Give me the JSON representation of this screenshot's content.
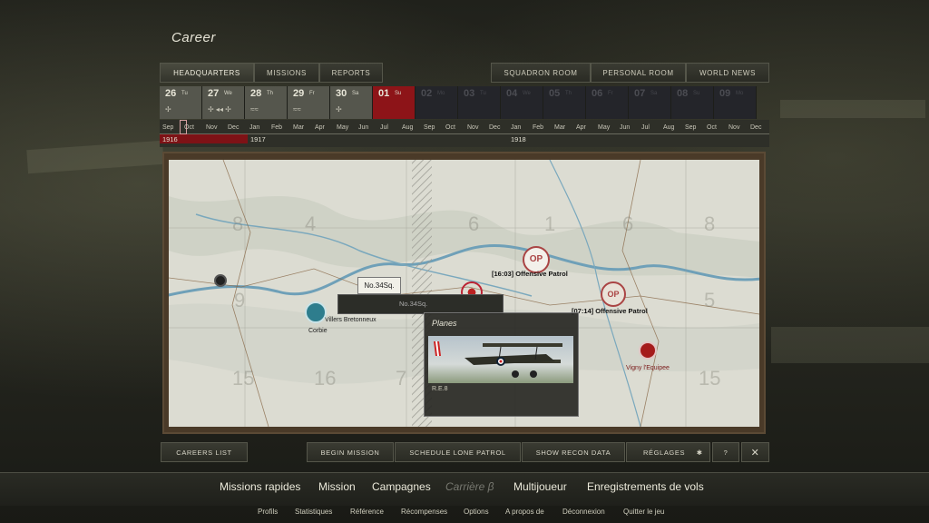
{
  "page": {
    "title": "Career"
  },
  "top_tabs_left": [
    {
      "label": "HEADQUARTERS",
      "active": true
    },
    {
      "label": "MISSIONS",
      "active": false
    },
    {
      "label": "REPORTS",
      "active": false
    }
  ],
  "top_tabs_right": [
    {
      "label": "SQUADRON ROOM"
    },
    {
      "label": "PERSONAL ROOM"
    },
    {
      "label": "WORLD NEWS"
    }
  ],
  "calendar_days": [
    {
      "num": "26",
      "day": "Tu",
      "weather": "✢",
      "state": "past"
    },
    {
      "num": "27",
      "day": "We",
      "weather": "✢ ◂◂ ✢",
      "state": "past"
    },
    {
      "num": "28",
      "day": "Th",
      "weather": "≈≈",
      "state": "past"
    },
    {
      "num": "29",
      "day": "Fr",
      "weather": "≈≈",
      "state": "past"
    },
    {
      "num": "30",
      "day": "Sa",
      "weather": "✢",
      "state": "past"
    },
    {
      "num": "01",
      "day": "Su",
      "weather": "",
      "state": "today"
    },
    {
      "num": "02",
      "day": "Mo",
      "weather": "",
      "state": "future"
    },
    {
      "num": "03",
      "day": "Tu",
      "weather": "",
      "state": "future"
    },
    {
      "num": "04",
      "day": "We",
      "weather": "",
      "state": "future"
    },
    {
      "num": "05",
      "day": "Th",
      "weather": "",
      "state": "future"
    },
    {
      "num": "06",
      "day": "Fr",
      "weather": "",
      "state": "future"
    },
    {
      "num": "07",
      "day": "Sa",
      "weather": "",
      "state": "future"
    },
    {
      "num": "08",
      "day": "Su",
      "weather": "",
      "state": "future"
    },
    {
      "num": "09",
      "day": "Mo",
      "weather": "",
      "state": "future"
    }
  ],
  "timeline": {
    "months": [
      "Sep",
      "Oct",
      "Nov",
      "Dec",
      "Jan",
      "Feb",
      "Mar",
      "Apr",
      "May",
      "Jun",
      "Jul",
      "Aug",
      "Sep",
      "Oct",
      "Nov",
      "Dec",
      "Jan",
      "Feb",
      "Mar",
      "Apr",
      "May",
      "Jun",
      "Jul",
      "Aug",
      "Sep",
      "Oct",
      "Nov",
      "Dec"
    ],
    "years": [
      "1916",
      "1917",
      "1918"
    ]
  },
  "map": {
    "grid_numbers": [
      "8",
      "4",
      "6",
      "1",
      "6",
      "8",
      "9",
      "5",
      "9",
      "15",
      "16",
      "7",
      "15"
    ],
    "towns": [
      "Corbie",
      "Villers Bretonneux",
      "Vigny l'Equipee"
    ],
    "patrols": [
      {
        "time_label": "[16:03] Offensive Patrol",
        "icon_text": "OP"
      },
      {
        "time_label": "[07:14] Offensive Patrol",
        "icon_text": "OP"
      }
    ],
    "squadron_tooltip": "No.34Sq.",
    "squadron_bar_label": "No.34Sq.",
    "planes_panel": {
      "title": "Planes",
      "plane_name": "R.E.8"
    }
  },
  "bottom_buttons": {
    "careers_list": "CAREERS LIST",
    "begin_mission": "BEGIN MISSION",
    "schedule_lone_patrol": "SCHEDULE LONE PATROL",
    "show_recon_data": "SHOW RECON DATA",
    "settings": "RÉGLAGES"
  },
  "main_menu": [
    "Missions rapides",
    "Mission",
    "Campagnes",
    "Carrière β",
    "Multijoueur",
    "Enregistrements de vols"
  ],
  "sub_menu": [
    "Profils",
    "Statistiques",
    "Référence",
    "Récompenses",
    "Options",
    "A propos de",
    "Déconnexion",
    "Quitter le jeu"
  ],
  "colors": {
    "today": "#8d1418",
    "accent_red": "#7e1216"
  }
}
